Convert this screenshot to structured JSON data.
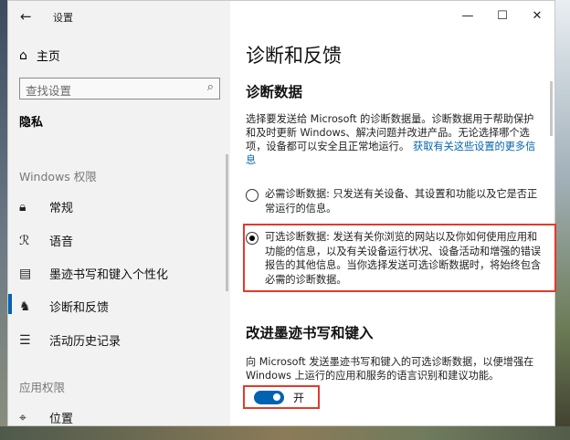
{
  "window": {
    "title": "设置",
    "back_icon": "back-arrow-icon",
    "controls": [
      "—",
      "☐",
      "✕"
    ]
  },
  "sidebar": {
    "home": {
      "label": "主页",
      "icon": "home-icon"
    },
    "search": {
      "placeholder": "查找设置",
      "icon": "search-icon"
    },
    "section": "隐私",
    "groups": [
      {
        "label": "Windows 权限",
        "items": [
          {
            "label": "常规",
            "icon": "lock-icon"
          },
          {
            "label": "语音",
            "icon": "speech-icon"
          },
          {
            "label": "墨迹书写和键入个性化",
            "icon": "clipboard-icon"
          },
          {
            "label": "诊断和反馈",
            "icon": "feedback-icon",
            "active": true
          },
          {
            "label": "活动历史记录",
            "icon": "timeline-icon"
          }
        ]
      },
      {
        "label": "应用权限",
        "items": [
          {
            "label": "位置",
            "icon": "location-icon"
          }
        ]
      }
    ]
  },
  "main": {
    "title": "诊断和反馈",
    "diag_heading": "诊断数据",
    "diag_desc": "选择要发送给 Microsoft 的诊断数据量。诊断数据用于帮助保护和及时更新 Windows、解决问题并改进产品。无论选择哪个选项，设备都可以安全且正常地运行。",
    "learn_more": "获取有关这些设置的更多信息",
    "options": [
      {
        "text": "必需诊断数据: 只发送有关设备、其设置和功能以及它是否正常运行的信息。",
        "checked": false
      },
      {
        "text": "可选诊断数据: 发送有关你浏览的网站以及你如何使用应用和功能的信息，以及有关设备运行状况、设备活动和增强的错误报告的其他信息。当你选择发送可选诊断数据时，将始终包含必需的诊断数据。",
        "checked": true
      }
    ],
    "ink_heading": "改进墨迹书写和键入",
    "ink_desc": "向 Microsoft 发送墨迹书写和键入的可选诊断数据，以便增强在 Windows 上运行的应用和服务的语言识别和建议功能。",
    "toggle": {
      "label": "开",
      "on": true
    }
  },
  "colors": {
    "accent": "#0063b1",
    "highlight": "#e23b2a"
  }
}
